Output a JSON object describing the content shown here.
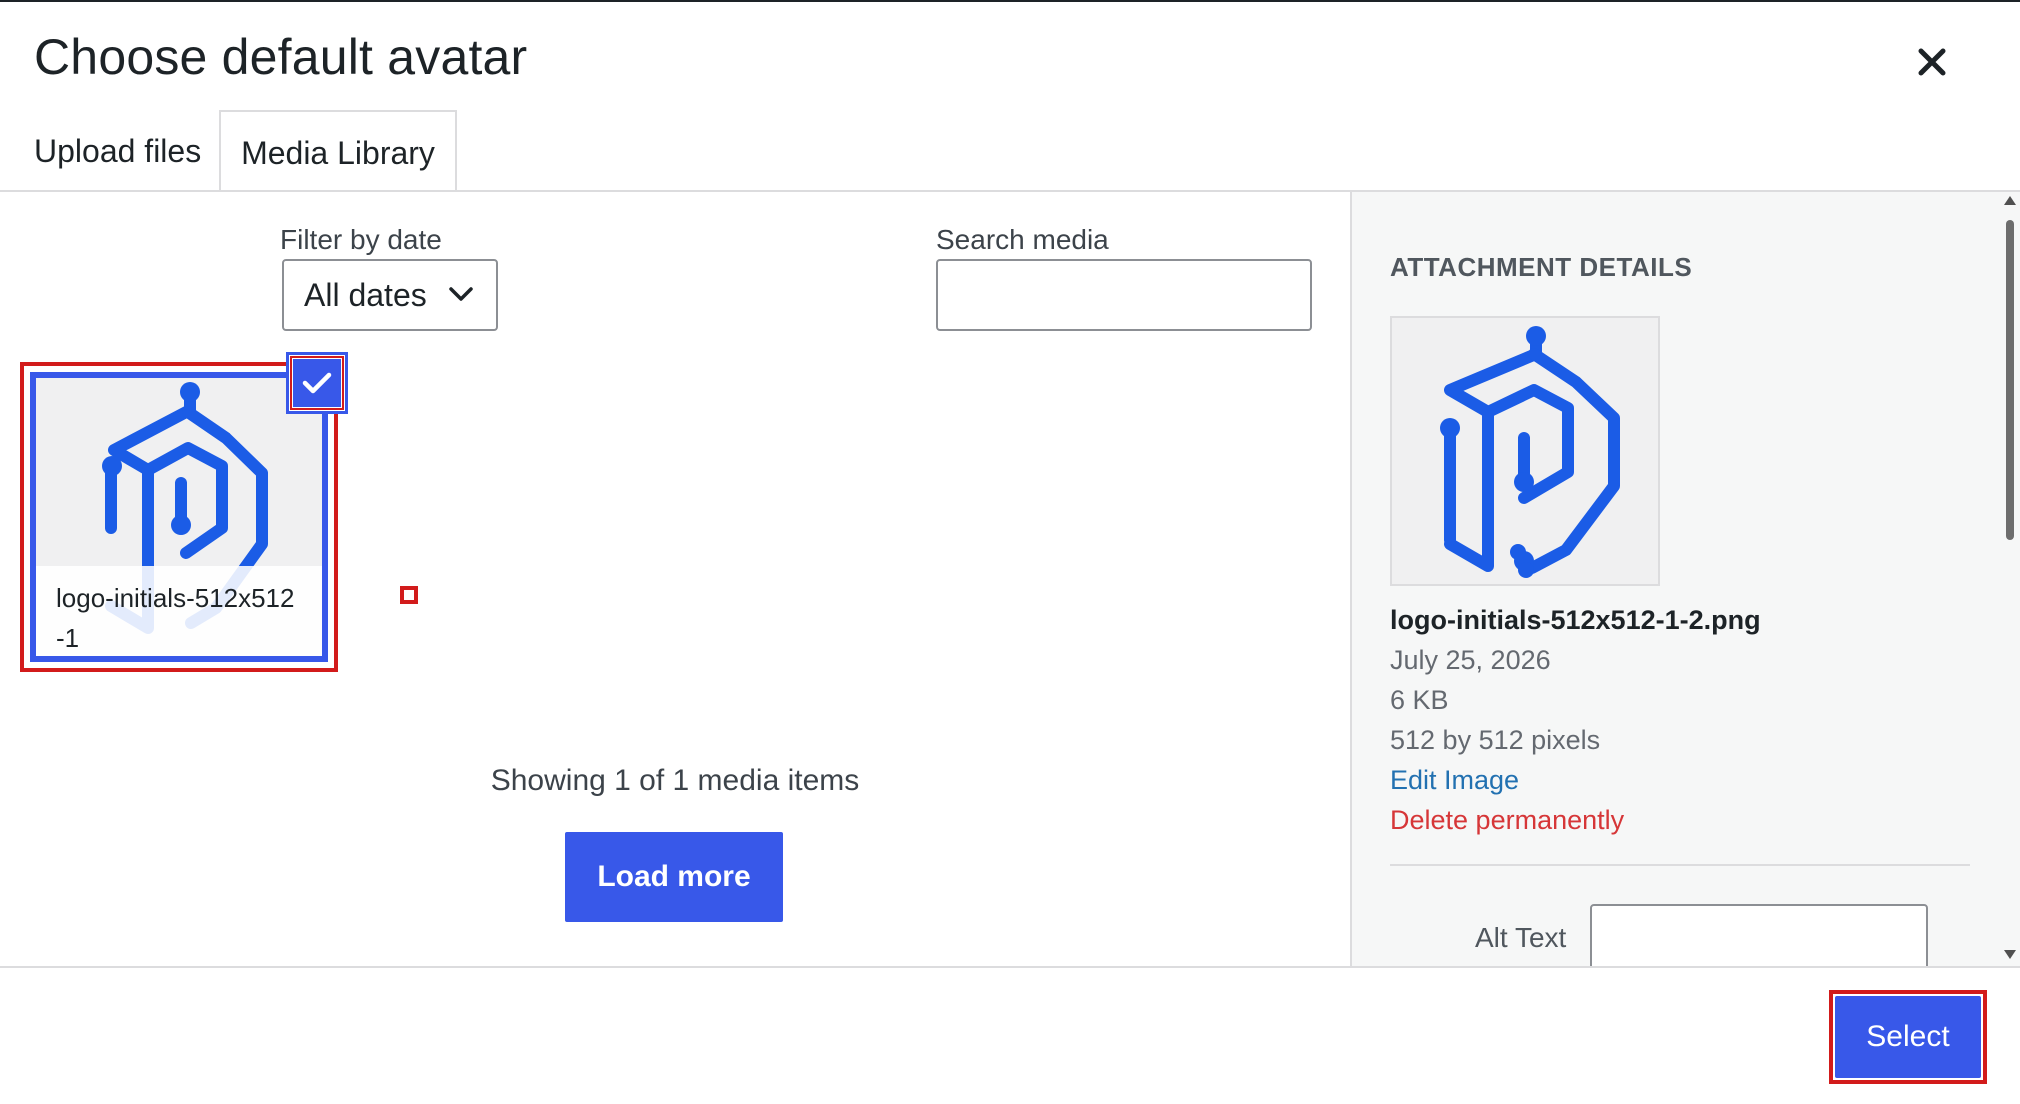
{
  "modal": {
    "title": "Choose default avatar",
    "close_icon": "close-icon"
  },
  "tabs": [
    {
      "label": "Upload files",
      "active": false
    },
    {
      "label": "Media Library",
      "active": true
    }
  ],
  "filters": {
    "date_label": "Filter by date",
    "date_selected": "All dates",
    "search_label": "Search media",
    "search_value": ""
  },
  "attachments": [
    {
      "filename": "logo-initials-512x512-1",
      "selected": true
    }
  ],
  "pagination": {
    "showing": "Showing 1 of 1 media items",
    "load_more_label": "Load more"
  },
  "details": {
    "heading": "Attachment Details",
    "filename": "logo-initials-512x512-1-2.png",
    "date": "July 25, 2026",
    "filesize": "6 KB",
    "dimensions": "512 by 512 pixels",
    "edit_label": "Edit Image",
    "delete_label": "Delete permanently",
    "alt_text_label": "Alt Text",
    "alt_text_value": ""
  },
  "toolbar": {
    "select_label": "Select"
  },
  "colors": {
    "accent": "#3858e9",
    "logo": "#1b5ce6",
    "highlight": "#d21b1b",
    "link": "#2271b1",
    "danger": "#d63638"
  }
}
